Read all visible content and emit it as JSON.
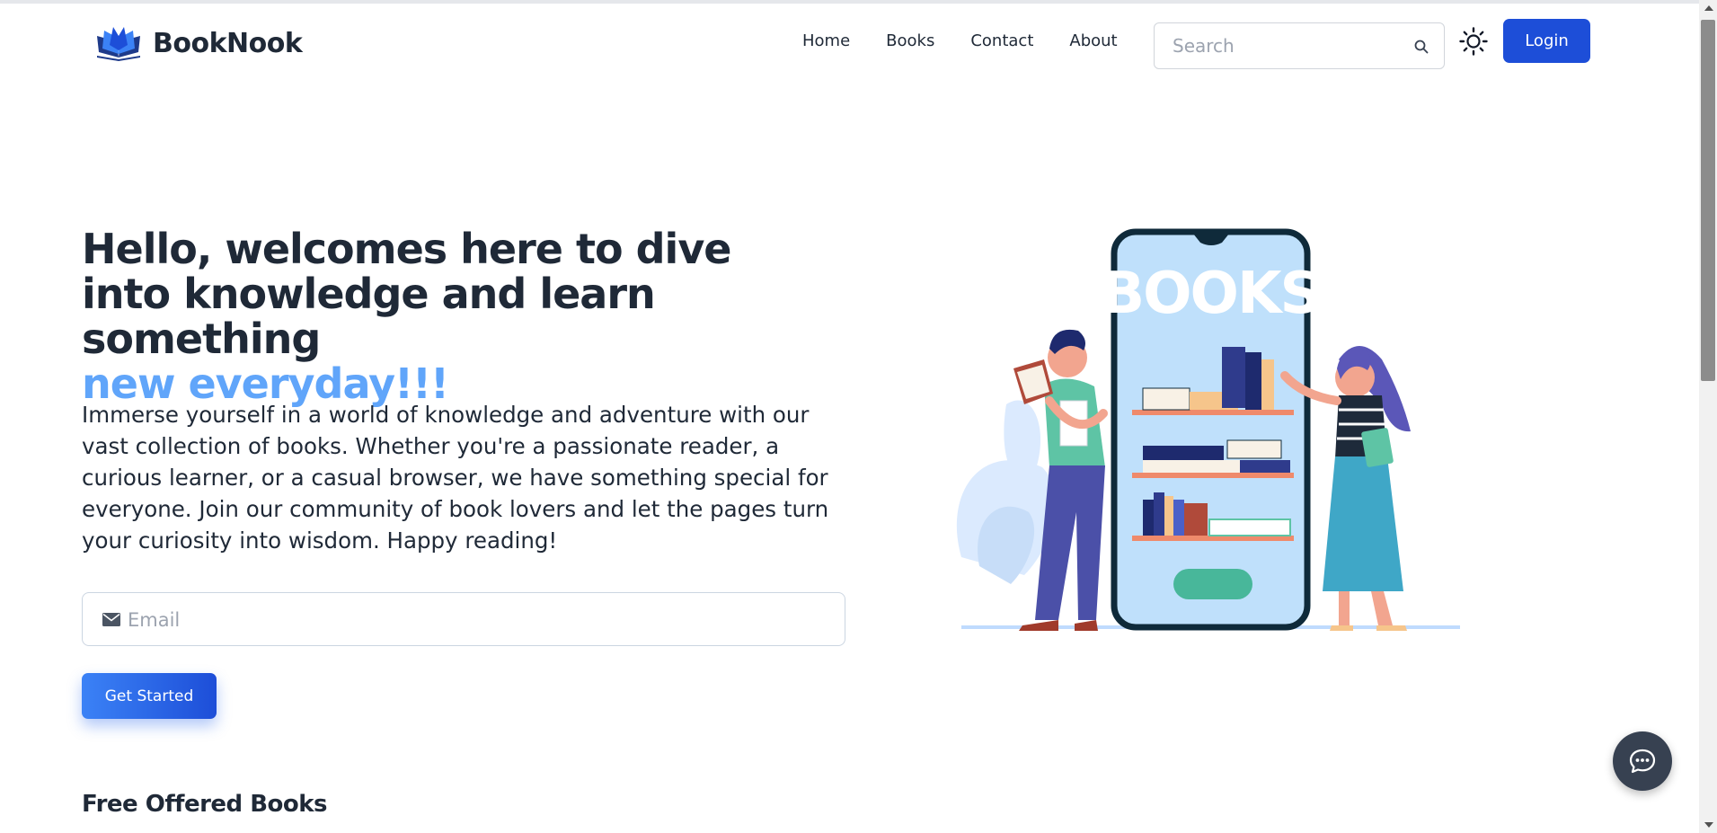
{
  "brand": {
    "name": "BookNook"
  },
  "nav": {
    "links": [
      "Home",
      "Books",
      "Contact",
      "About"
    ]
  },
  "search": {
    "placeholder": "Search"
  },
  "header": {
    "login_label": "Login"
  },
  "hero": {
    "title_line1": "Hello, welcomes here to dive into knowledge and learn something",
    "title_accent": "new everyday!!!",
    "description": "Immerse yourself in a world of knowledge and adventure with our vast collection of books. Whether you're a passionate reader, a curious learner, or a casual browser, we have something special for everyone. Join our community of book lovers and let the pages turn your curiosity into wisdom. Happy reading!",
    "email_placeholder": "Email",
    "cta_label": "Get Started"
  },
  "illustration": {
    "sign_text": "BOOKS"
  },
  "sections": {
    "free_books_title": "Free Offered Books"
  },
  "colors": {
    "primary": "#1d4ed8",
    "accent": "#60a5fa",
    "text": "#1f2937",
    "chat_button": "#374151"
  },
  "icons": [
    "open-book-logo-icon",
    "search-icon",
    "sun-icon",
    "mail-icon",
    "chat-bubble-icon"
  ]
}
